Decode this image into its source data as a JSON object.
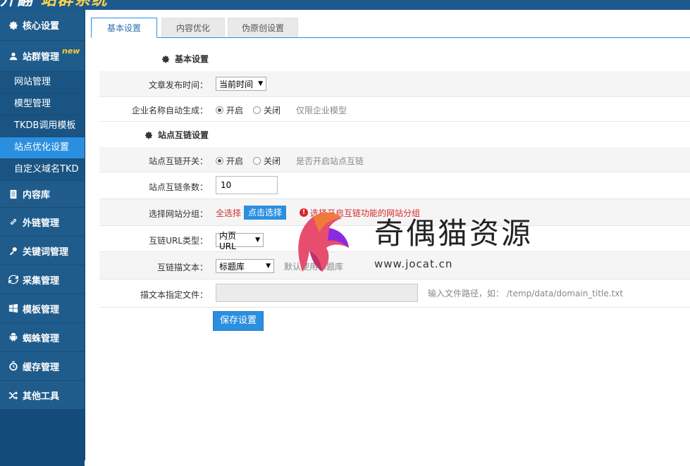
{
  "brand": {
    "logo_text_a": "开翻 ",
    "logo_text_b": "站群系统"
  },
  "sidebar": {
    "groups": [
      {
        "label": "核心设置",
        "icon": "gear-icon"
      },
      {
        "label": "站群管理",
        "icon": "user-icon",
        "badge": "new"
      },
      {
        "label": "内容库",
        "icon": "document-icon"
      },
      {
        "label": "外链管理",
        "icon": "link-icon"
      },
      {
        "label": "关键词管理",
        "icon": "key-icon"
      },
      {
        "label": "采集管理",
        "icon": "refresh-icon"
      },
      {
        "label": "模板管理",
        "icon": "windows-icon"
      },
      {
        "label": "蜘蛛管理",
        "icon": "android-icon"
      },
      {
        "label": "缓存管理",
        "icon": "stopwatch-icon"
      },
      {
        "label": "其他工具",
        "icon": "shuffle-icon"
      }
    ],
    "subitems": [
      "网站管理",
      "模型管理",
      "TKDB调用模板",
      "站点优化设置",
      "自定义域名TKD"
    ],
    "active_subitem": "站点优化设置"
  },
  "tabs": [
    {
      "label": "基本设置",
      "active": true
    },
    {
      "label": "内容优化",
      "active": false
    },
    {
      "label": "伪原创设置",
      "active": false
    }
  ],
  "sections": {
    "basic": {
      "title": "基本设置"
    },
    "interlink": {
      "title": "站点互链设置"
    }
  },
  "form": {
    "publish_time": {
      "label": "文章发布时间：",
      "value": "当前时间"
    },
    "company_autogen": {
      "label": "企业名称自动生成：",
      "on": "开启",
      "off": "关闭",
      "selected": "on",
      "hint": "仅限企业模型"
    },
    "interlink_switch": {
      "label": "站点互链开关：",
      "on": "开启",
      "off": "关闭",
      "selected": "on",
      "hint": "是否开启站点互链"
    },
    "interlink_count": {
      "label": "站点互链条数：",
      "value": "10"
    },
    "site_group": {
      "label": "选择网站分组：",
      "prefix": "全选择",
      "button": "点击选择",
      "warning": "选择开启互链功能的网站分组"
    },
    "url_type": {
      "label": "互链URL类型：",
      "value": "内页URL"
    },
    "anchor_text": {
      "label": "互链描文本：",
      "value": "标题库",
      "hint": "默认使用标题库"
    },
    "anchor_file": {
      "label": "描文本指定文件：",
      "value": "",
      "hint": "输入文件路径，如： /temp/data/domain_title.txt"
    }
  },
  "save_button": "保存设置",
  "watermark": {
    "text_cn": "奇偶猫资源",
    "text_en": "www.jocat.cn"
  },
  "colors": {
    "sidebar": "#1f5c8c",
    "accent": "#2b8fe0",
    "warning": "#d9262a",
    "badge": "#ffcc33"
  }
}
